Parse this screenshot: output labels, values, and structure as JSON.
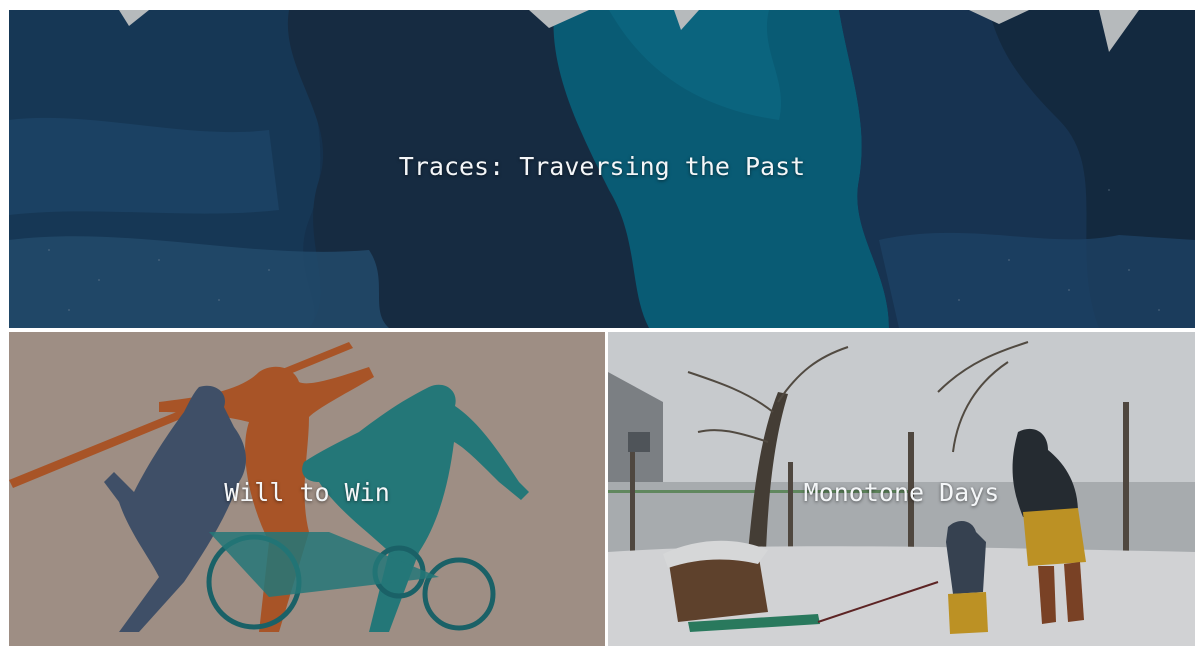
{
  "gallery": {
    "tiles": [
      {
        "title": "Traces: Traversing the Past"
      },
      {
        "title": "Will to Win"
      },
      {
        "title": "Monotone Days"
      }
    ]
  },
  "colors": {
    "page_background": "#ffffff",
    "tile1_deep_navy": "#163452",
    "tile1_teal": "#0b6f8e",
    "tile2_beige": "#b8a69a",
    "tile2_orange": "#c4622e",
    "tile2_slate": "#4a5d78",
    "tile2_teal": "#2a8b8c",
    "tile3_snow": "#e7e9ec",
    "tile3_coat": "#2b3138",
    "tile3_skirt": "#d6a62a",
    "title_text": "#f4f6f8"
  }
}
